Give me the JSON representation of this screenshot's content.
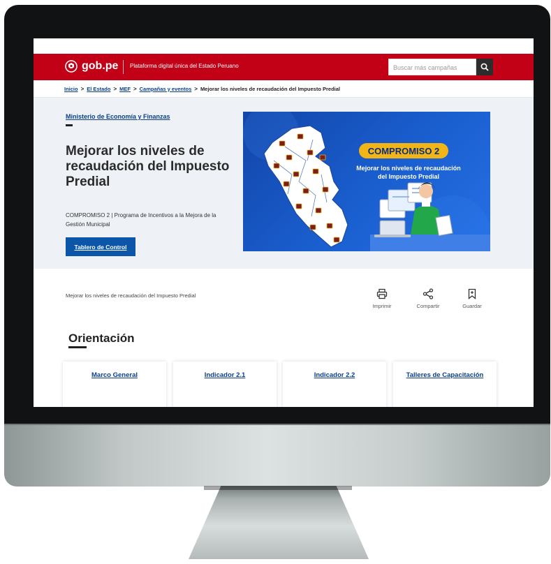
{
  "header": {
    "logo_text": "gob.pe",
    "tagline": "Plataforma digital única del Estado Peruano",
    "search_placeholder": "Buscar más campañas",
    "brand_color": "#c20016"
  },
  "breadcrumb": {
    "items": [
      "Inicio",
      "El Estado",
      "MEF",
      "Campañas y eventos"
    ],
    "current": "Mejorar los niveles de recaudación del Impuesto Predial",
    "separator": ">"
  },
  "hero": {
    "ministry": "Ministerio de Economía y Finanzas",
    "title": "Mejorar los niveles de recaudación del Impuesto Predial",
    "subtitle": "COMPROMISO 2 | Programa de Incentivos a la Mejora de la Gestión Municipal",
    "cta_label": "Tablero de Control",
    "banner": {
      "pill": "COMPROMISO 2",
      "line1": "Mejorar los niveles de recaudación",
      "line2": "del Impuesto Predial"
    }
  },
  "tools": {
    "description": "Mejorar los niveles de recaudación del Impuesto Predial",
    "print": "Imprimir",
    "share": "Compartir",
    "save": "Guardar"
  },
  "orientation": {
    "title": "Orientación",
    "cards": [
      "Marco General",
      "Indicador 2.1",
      "Indicador 2.2",
      "Talleres de Capacitación"
    ]
  },
  "icons": [
    "shield-logo-icon",
    "search-icon",
    "print-icon",
    "share-icon",
    "bookmark-icon"
  ]
}
